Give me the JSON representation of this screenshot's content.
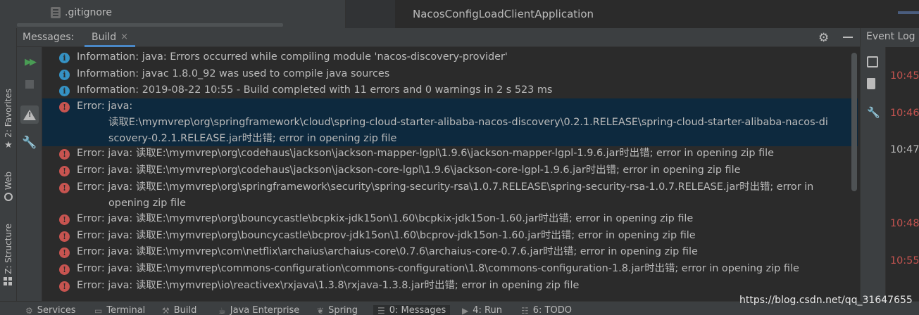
{
  "top": {
    "project_file": ".gitignore",
    "run_config_title": "NacosConfigLoadClientApplication"
  },
  "left_tool_tabs": [
    {
      "label": "2: Favorites",
      "icon": "star-icon"
    },
    {
      "label": "Web",
      "icon": "globe-icon"
    },
    {
      "label": "Z: Structure",
      "icon": "structure-icon"
    }
  ],
  "panel": {
    "title": "Messages:",
    "tab_label": "Build",
    "tab_close": "×"
  },
  "messages": [
    {
      "severity": "info",
      "text": "Information: java: Errors occurred while compiling module 'nacos-discovery-provider'"
    },
    {
      "severity": "info",
      "text": "Information: javac 1.8.0_92 was used to compile java sources"
    },
    {
      "severity": "info",
      "text": "Information: 2019-08-22 10:55 - Build completed with 11 errors and 0 warnings in 2 s 523 ms"
    },
    {
      "severity": "error",
      "selected": true,
      "text": "Error: java:",
      "cont": [
        "读取E:\\mymvrep\\org\\springframework\\cloud\\spring-cloud-starter-alibaba-nacos-discovery\\0.2.1.RELEASE\\spring-cloud-starter-alibaba-nacos-di",
        "scovery-0.2.1.RELEASE.jar时出错; error in opening zip file"
      ]
    },
    {
      "severity": "error",
      "text": "Error: java: 读取E:\\mymvrep\\org\\codehaus\\jackson\\jackson-mapper-lgpl\\1.9.6\\jackson-mapper-lgpl-1.9.6.jar时出错; error in opening zip file"
    },
    {
      "severity": "error",
      "text": "Error: java: 读取E:\\mymvrep\\org\\codehaus\\jackson\\jackson-core-lgpl\\1.9.6\\jackson-core-lgpl-1.9.6.jar时出错; error in opening zip file"
    },
    {
      "severity": "error",
      "text": "Error: java: 读取E:\\mymvrep\\org\\springframework\\security\\spring-security-rsa\\1.0.7.RELEASE\\spring-security-rsa-1.0.7.RELEASE.jar时出错; error in",
      "cont": [
        "opening zip file"
      ]
    },
    {
      "severity": "error",
      "text": "Error: java: 读取E:\\mymvrep\\org\\bouncycastle\\bcpkix-jdk15on\\1.60\\bcpkix-jdk15on-1.60.jar时出错; error in opening zip file"
    },
    {
      "severity": "error",
      "text": "Error: java: 读取E:\\mymvrep\\org\\bouncycastle\\bcprov-jdk15on\\1.60\\bcprov-jdk15on-1.60.jar时出错; error in opening zip file"
    },
    {
      "severity": "error",
      "text": "Error: java: 读取E:\\mymvrep\\com\\netflix\\archaius\\archaius-core\\0.7.6\\archaius-core-0.7.6.jar时出错; error in opening zip file"
    },
    {
      "severity": "error",
      "text": "Error: java: 读取E:\\mymvrep\\commons-configuration\\commons-configuration\\1.8\\commons-configuration-1.8.jar时出错; error in opening zip file"
    },
    {
      "severity": "error",
      "text": "Error: java: 读取E:\\mymvrep\\io\\reactivex\\rxjava\\1.3.8\\rxjava-1.3.8.jar时出错; error in opening zip file"
    }
  ],
  "event_log": {
    "title": "Event Log",
    "times": [
      "10:45",
      "10:46",
      "10:47",
      "10:48",
      "10:55"
    ],
    "time_colors": [
      "#c75450",
      "#c75450",
      "#bbbbbb",
      "#c75450",
      "#c75450"
    ]
  },
  "bottom_tabs": [
    {
      "label": "Services",
      "icon": "services-icon"
    },
    {
      "label": "Terminal",
      "icon": "terminal-icon"
    },
    {
      "label": "Build",
      "icon": "hammer-icon"
    },
    {
      "label": "Java Enterprise",
      "icon": "java-ee-icon"
    },
    {
      "label": "Spring",
      "icon": "spring-icon"
    },
    {
      "label": "0: Messages",
      "icon": "messages-icon",
      "active": true
    },
    {
      "label": "4: Run",
      "icon": "run-icon"
    },
    {
      "label": "6: TODO",
      "icon": "todo-icon"
    }
  ],
  "watermark": "https://blog.csdn.net/qq_31647655",
  "colors": {
    "background": "#2b2b2b",
    "panel": "#3c3f41",
    "selection": "#0d293e",
    "info": "#3592c4",
    "error": "#c75450",
    "accent": "#4a88c7"
  }
}
